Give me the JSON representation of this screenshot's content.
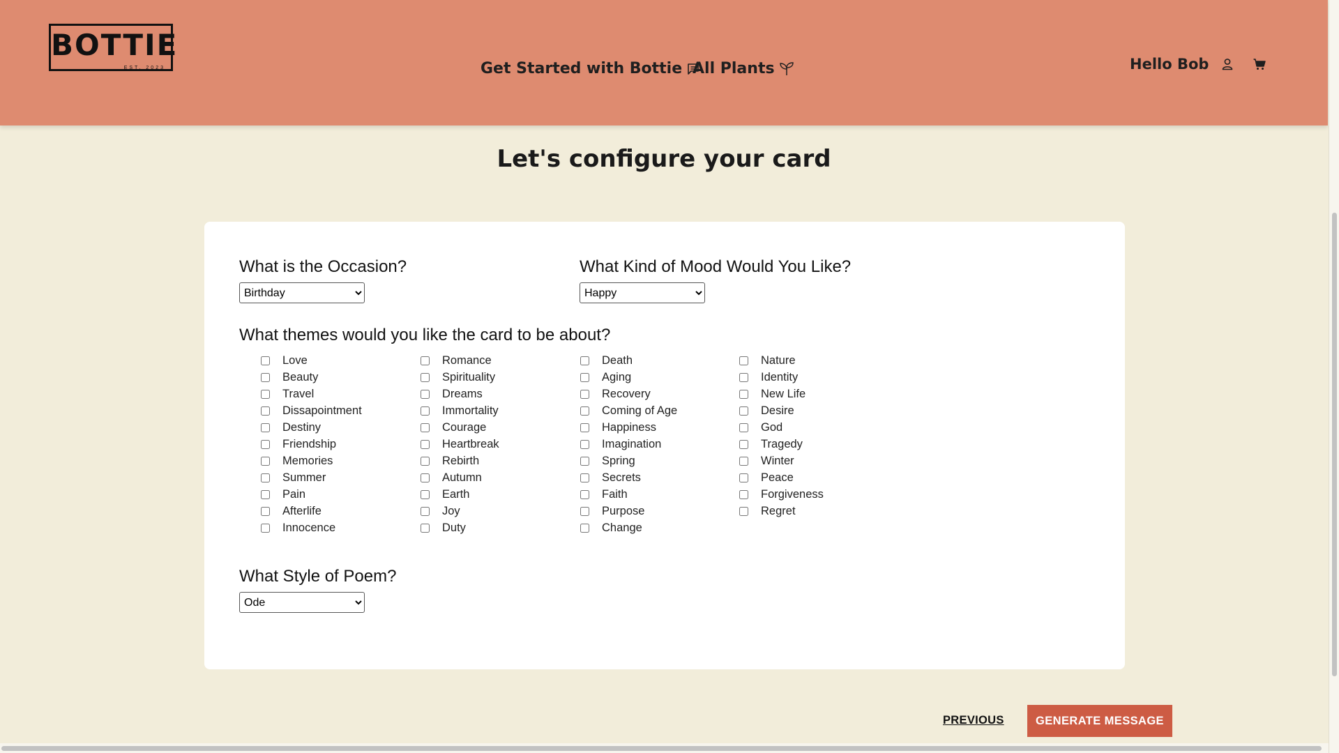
{
  "header": {
    "logo_text": "BOTTIE",
    "logo_sub": "EST. 2023",
    "nav": [
      {
        "label": "Get Started with Bottie",
        "icon": "chat-icon"
      },
      {
        "label": "All Plants",
        "icon": "sprout-icon"
      }
    ],
    "greeting": "Hello Bob",
    "icons": [
      "user-icon",
      "cart-icon"
    ]
  },
  "page_title": "Let's configure your card",
  "form": {
    "occasion": {
      "question": "What is the Occasion?",
      "value": "Birthday"
    },
    "mood": {
      "question": "What Kind of Mood Would You Like?",
      "value": "Happy"
    },
    "themes": {
      "question": "What themes would you like the card to be about?",
      "columns": [
        [
          "Love",
          "Beauty",
          "Travel",
          "Dissapointment",
          "Destiny",
          "Friendship",
          "Memories",
          "Summer",
          "Pain",
          "Afterlife",
          "Innocence"
        ],
        [
          "Romance",
          "Spirituality",
          "Dreams",
          "Immortality",
          "Courage",
          "Heartbreak",
          "Rebirth",
          "Autumn",
          "Earth",
          "Joy",
          "Duty"
        ],
        [
          "Death",
          "Aging",
          "Recovery",
          "Coming of Age",
          "Happiness",
          "Imagination",
          "Spring",
          "Secrets",
          "Faith",
          "Purpose",
          "Change"
        ],
        [
          "Nature",
          "Identity",
          "New Life",
          "Desire",
          "God",
          "Tragedy",
          "Winter",
          "Peace",
          "Forgiveness",
          "Regret"
        ]
      ]
    },
    "style": {
      "question": "What Style of Poem?",
      "value": "Ode"
    }
  },
  "actions": {
    "previous": "PREVIOUS",
    "generate": "GENERATE MESSAGE"
  },
  "colors": {
    "header_bg": "#de8b70",
    "page_bg": "#f2edda",
    "card_bg": "#ffffff",
    "button_bg": "#cd5c44"
  }
}
